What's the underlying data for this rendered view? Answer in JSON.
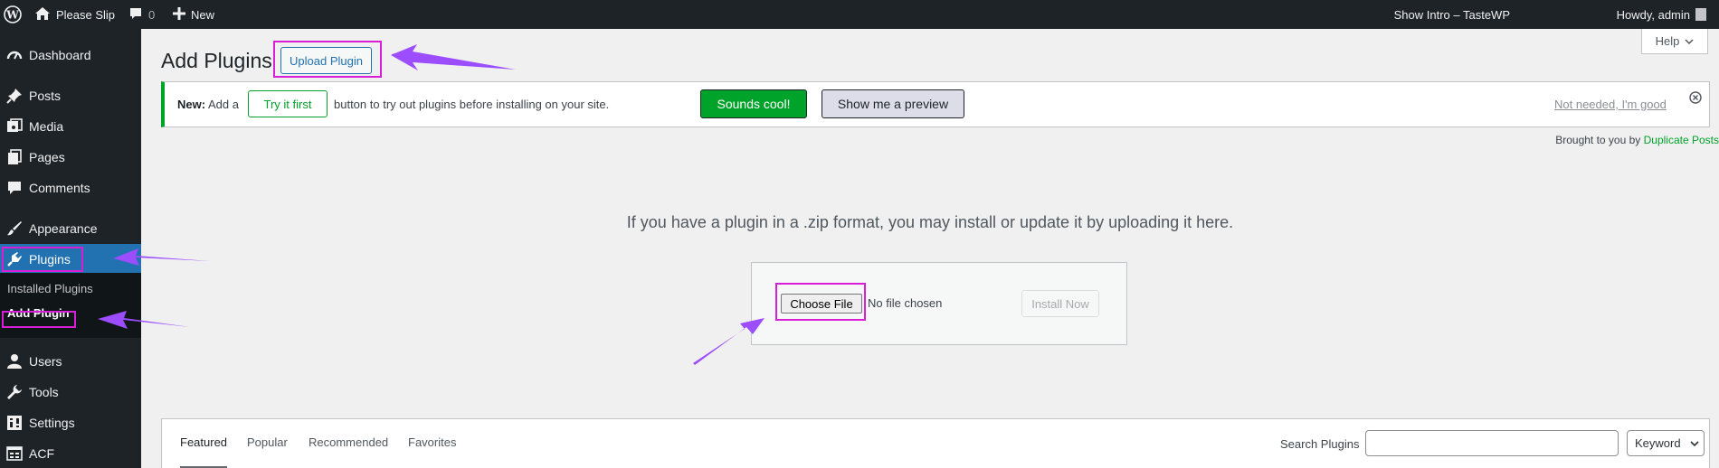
{
  "adminbar": {
    "site_name": "Please Slip",
    "comment_count": "0",
    "new_label": "New",
    "show_intro": "Show Intro – TasteWP",
    "howdy": "Howdy, admin"
  },
  "sidebar": {
    "items": [
      {
        "label": "Dashboard",
        "icon": "dashboard-icon"
      },
      {
        "label": "Posts",
        "icon": "pin-icon"
      },
      {
        "label": "Media",
        "icon": "media-icon"
      },
      {
        "label": "Pages",
        "icon": "pages-icon"
      },
      {
        "label": "Comments",
        "icon": "comment-icon"
      },
      {
        "label": "Appearance",
        "icon": "brush-icon"
      },
      {
        "label": "Plugins",
        "icon": "plugin-icon"
      },
      {
        "label": "Users",
        "icon": "user-icon"
      },
      {
        "label": "Tools",
        "icon": "wrench-icon"
      },
      {
        "label": "Settings",
        "icon": "settings-icon"
      },
      {
        "label": "ACF",
        "icon": "acf-icon"
      }
    ],
    "submenu": [
      "Installed Plugins",
      "Add Plugin"
    ]
  },
  "main": {
    "title": "Add Plugins",
    "upload_button": "Upload Plugin",
    "help": "Help",
    "notice": {
      "new_label": "New:",
      "text_before": "Add a",
      "try_button": "Try it first",
      "text_after": "button to try out plugins before installing on your site.",
      "cool_button": "Sounds cool!",
      "preview_button": "Show me a preview",
      "dismiss_link": "Not needed, I'm good"
    },
    "brought_by": "Brought to you by",
    "brought_link": "Duplicate Posts",
    "upload_instructions": "If you have a plugin in a .zip format, you may install or update it by uploading it here.",
    "choose_file": "Choose File",
    "no_file": "No file chosen",
    "install_button": "Install Now",
    "tabs": [
      "Featured",
      "Popular",
      "Recommended",
      "Favorites"
    ],
    "search_label": "Search Plugins",
    "search_value": "",
    "search_type": "Keyword"
  },
  "colors": {
    "admin_dark": "#1d2327",
    "accent_blue": "#2271b1",
    "green": "#00a32a",
    "annotation_magenta": "#d61fd6",
    "annotation_arrow": "#9b4dff"
  }
}
